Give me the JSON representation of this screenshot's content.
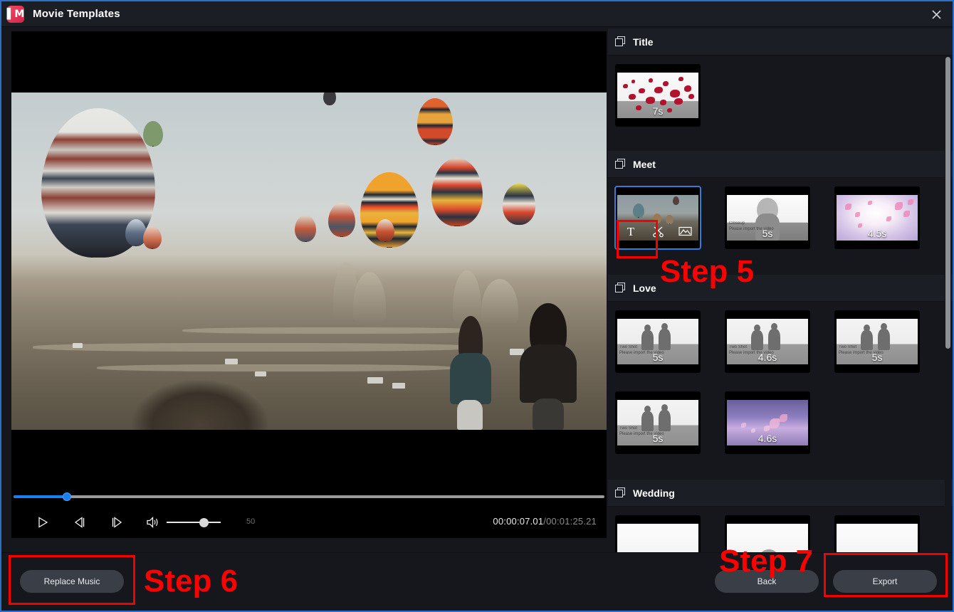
{
  "window": {
    "title": "Movie Templates",
    "logo_icon": "app-logo-icon",
    "close_icon": "close-icon"
  },
  "preview": {
    "scene_description": "Hot air balloons over Cappadocia with two people holding hands",
    "controls": {
      "play_icon": "play-icon",
      "prev_frame_icon": "previous-frame-icon",
      "next_frame_icon": "next-frame-icon",
      "volume_icon": "volume-icon",
      "volume_value": "50",
      "current_time": "00:00:07.01",
      "separator": "/",
      "total_time": "00:01:25.21",
      "seek_percent": 8,
      "volume_percent": 62
    }
  },
  "panel": {
    "sections": [
      {
        "id": "title",
        "label": "Title",
        "icon": "layers-icon",
        "templates": [
          {
            "duration": "7s",
            "style": "splatter",
            "selected": false
          }
        ]
      },
      {
        "id": "meet",
        "label": "Meet",
        "icon": "layers-icon",
        "templates": [
          {
            "duration": "",
            "style": "balloonthumb",
            "selected": true,
            "overlay": [
              {
                "icon": "text-icon",
                "glyph": "T",
                "label": "Edit text"
              },
              {
                "icon": "scissors-icon",
                "glyph": "scissors",
                "label": "Trim clip"
              },
              {
                "icon": "image-icon",
                "glyph": "image",
                "label": "Replace media"
              }
            ]
          },
          {
            "duration": "5s",
            "style": "closeup",
            "selected": false,
            "placeholder_title": "Closeup",
            "placeholder_body": "Please import the video"
          },
          {
            "duration": "4.5s",
            "style": "petals",
            "selected": false
          }
        ]
      },
      {
        "id": "love",
        "label": "Love",
        "icon": "layers-icon",
        "templates": [
          {
            "duration": "5s",
            "style": "twoshot",
            "selected": false,
            "placeholder_title": "Two Shot",
            "placeholder_body": "Please import the video"
          },
          {
            "duration": "4.6s",
            "style": "twoshot",
            "selected": false,
            "placeholder_title": "Two Shot",
            "placeholder_body": "Please import the video"
          },
          {
            "duration": "5s",
            "style": "twoshot",
            "selected": false,
            "placeholder_title": "Two Shot",
            "placeholder_body": "Please import the video"
          },
          {
            "duration": "5s",
            "style": "twoshot",
            "selected": false,
            "placeholder_title": "Two Shot",
            "placeholder_body": "Please import the video"
          },
          {
            "duration": "4.6s",
            "style": "petals",
            "selected": false
          }
        ]
      },
      {
        "id": "wedding",
        "label": "Wedding",
        "icon": "layers-icon",
        "templates": [
          {
            "duration": "",
            "style": "wedding",
            "selected": false
          },
          {
            "duration": "",
            "style": "wedding",
            "selected": false
          },
          {
            "duration": "",
            "style": "wedding",
            "selected": false
          }
        ]
      }
    ]
  },
  "bottom_bar": {
    "replace_music_label": "Replace Music",
    "back_label": "Back",
    "export_label": "Export"
  },
  "annotations": [
    {
      "id": "step5",
      "text": "Step 5"
    },
    {
      "id": "step6",
      "text": "Step 6"
    },
    {
      "id": "step7",
      "text": "Step 7"
    }
  ],
  "colors": {
    "accent_blue": "#1a7ff0",
    "selection_blue": "#2f7fd6",
    "annotation_red": "#f40000",
    "panel_bg": "#15171c",
    "titlebar_bg": "#1b1e24",
    "button_bg": "#3a3e46",
    "window_border": "#2a6fc9"
  }
}
